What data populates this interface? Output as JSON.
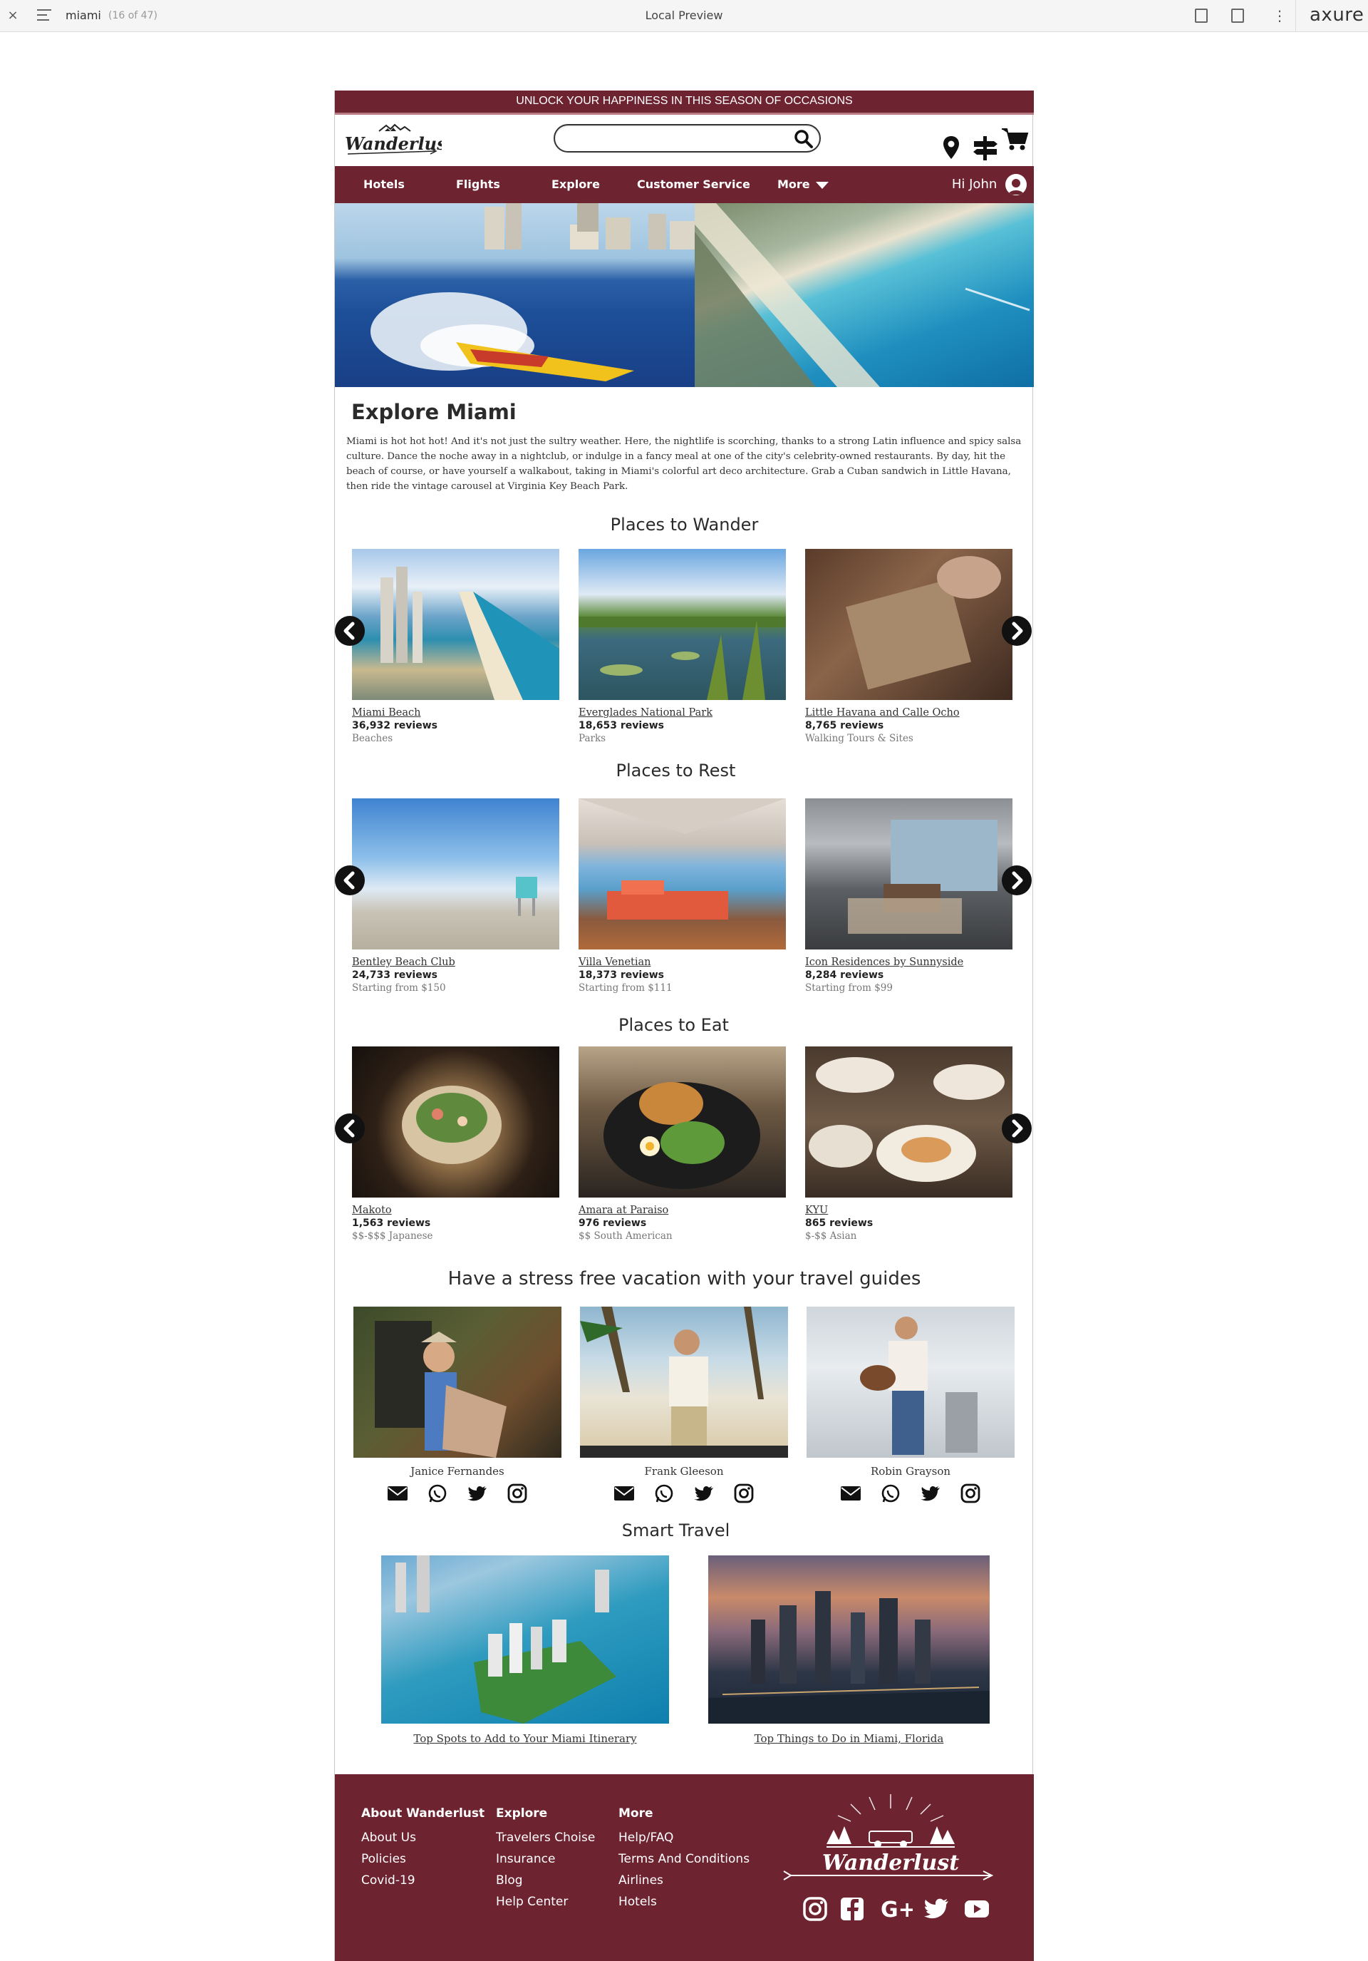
{
  "toolbar": {
    "close_symbol": "×",
    "page_name": "miami",
    "page_count": "(16 of 47)",
    "title": "Local Preview",
    "more_symbol": "⋮",
    "brand": "axure"
  },
  "colors": {
    "brand": "#6e2330",
    "text": "#2b2b2b"
  },
  "promo": "UNLOCK YOUR HAPPINESS IN THIS SEASON OF OCCASIONS",
  "header": {
    "logo_text": "Wanderlust",
    "search_value": "",
    "icons": [
      "location-pin-icon",
      "signpost-icon",
      "shopping-cart-icon"
    ]
  },
  "nav": {
    "items": [
      "Hotels",
      "Flights",
      "Explore",
      "Customer Service",
      "More"
    ],
    "greeting": "Hi John"
  },
  "page": {
    "title": "Explore Miami",
    "intro": "Miami is hot hot hot! And it's not just the sultry weather. Here, the nightlife is scorching, thanks to a strong Latin influence and spicy salsa culture. Dance the noche away in a nightclub, or indulge in a fancy meal at one of the city's celebrity-owned restaurants. By day, hit the beach of course, or have yourself a walkabout, taking in Miami's colorful art deco architecture. Grab a Cuban sandwich in Little Havana, then ride the vintage carousel at Virginia Key Beach Park."
  },
  "sections": {
    "wander": {
      "title": "Places to Wander",
      "cards": [
        {
          "name": "Miami Beach",
          "reviews": "36,932 reviews",
          "meta": "Beaches"
        },
        {
          "name": "Everglades National Park",
          "reviews": "18,653 reviews",
          "meta": "Parks"
        },
        {
          "name": "Little Havana and Calle Ocho",
          "reviews": "8,765 reviews",
          "meta": "Walking Tours & Sites"
        }
      ]
    },
    "rest": {
      "title": "Places to Rest",
      "cards": [
        {
          "name": "Bentley Beach Club",
          "reviews": "24,733 reviews",
          "meta": "Starting from $150"
        },
        {
          "name": "Villa Venetian",
          "reviews": "18,373 reviews",
          "meta": "Starting from $111"
        },
        {
          "name": "Icon Residences by Sunnyside",
          "reviews": "8,284 reviews",
          "meta": "Starting from $99"
        }
      ]
    },
    "eat": {
      "title": "Places to Eat",
      "cards": [
        {
          "name": "Makoto",
          "reviews": "1,563 reviews",
          "meta": "$$-$$$ Japanese"
        },
        {
          "name": "Amara at Paraiso",
          "reviews": "976 reviews",
          "meta": "$$ South American"
        },
        {
          "name": "KYU",
          "reviews": "865 reviews",
          "meta": "$-$$ Asian"
        }
      ]
    },
    "guides": {
      "title": "Have a stress free vacation with your travel guides",
      "people": [
        "Janice Fernandes",
        "Frank Gleeson",
        "Robin Grayson"
      ],
      "contact_icons": [
        "email-icon",
        "whatsapp-icon",
        "twitter-icon",
        "instagram-icon"
      ]
    },
    "smart": {
      "title": "Smart Travel",
      "articles": [
        "Top Spots to Add to Your Miami Itinerary",
        "Top Things to Do in Miami, Florida"
      ]
    }
  },
  "footer": {
    "columns": [
      {
        "heading": "About Wanderlust",
        "links": [
          "About Us",
          "Policies",
          "Covid-19"
        ]
      },
      {
        "heading": "Explore",
        "links": [
          "Travelers Choise",
          "Insurance",
          "Blog",
          "Help Center"
        ]
      },
      {
        "heading": "More",
        "links": [
          "Help/FAQ",
          "Terms And Conditions",
          "Airlines",
          "Hotels"
        ]
      }
    ],
    "logo_text": "Wanderlust",
    "social_icons": [
      "instagram-icon",
      "facebook-icon",
      "google-plus-icon",
      "twitter-icon",
      "youtube-icon"
    ]
  }
}
